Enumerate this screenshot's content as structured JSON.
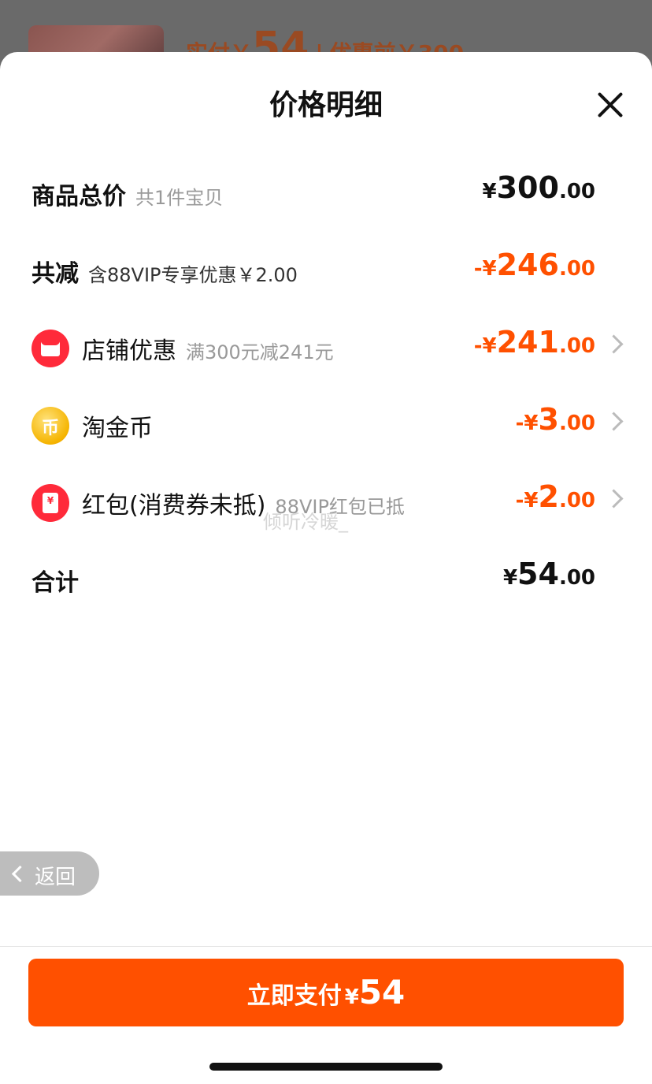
{
  "background": {
    "price_prefix": "实付￥",
    "price_value": "54",
    "separator": "|",
    "original_price": "优惠前￥300"
  },
  "sheet": {
    "title": "价格明细"
  },
  "rows": {
    "total": {
      "label": "商品总价",
      "sub": "共1件宝贝",
      "prefix": "",
      "yen": "¥",
      "int": "300",
      "dec": ".00"
    },
    "discount": {
      "label": "共减",
      "sub": "含88VIP专享优惠￥2.00",
      "prefix": "-",
      "yen": "¥",
      "int": "246",
      "dec": ".00"
    },
    "store": {
      "label": "店铺优惠",
      "sub": "满300元减241元",
      "prefix": "-",
      "yen": "¥",
      "int": "241",
      "dec": ".00"
    },
    "coin": {
      "label": "淘金币",
      "icon_char": "币",
      "prefix": "-",
      "yen": "¥",
      "int": "3",
      "dec": ".00"
    },
    "redpacket": {
      "label": "红包(消费券未抵)",
      "sub": "88VIP红包已抵",
      "icon_char": "¥",
      "prefix": "-",
      "yen": "¥",
      "int": "2",
      "dec": ".00"
    },
    "sum": {
      "label": "合计",
      "prefix": "",
      "yen": "¥",
      "int": "54",
      "dec": ".00"
    }
  },
  "watermark": "倾听冷暖_",
  "back": {
    "label": "返回"
  },
  "pay": {
    "label": "立即支付",
    "yen": "¥",
    "amount": "54"
  },
  "colors": {
    "accent": "#ff5000",
    "icon_red": "#ff2a3a",
    "coin_gold": "#f5b400"
  }
}
